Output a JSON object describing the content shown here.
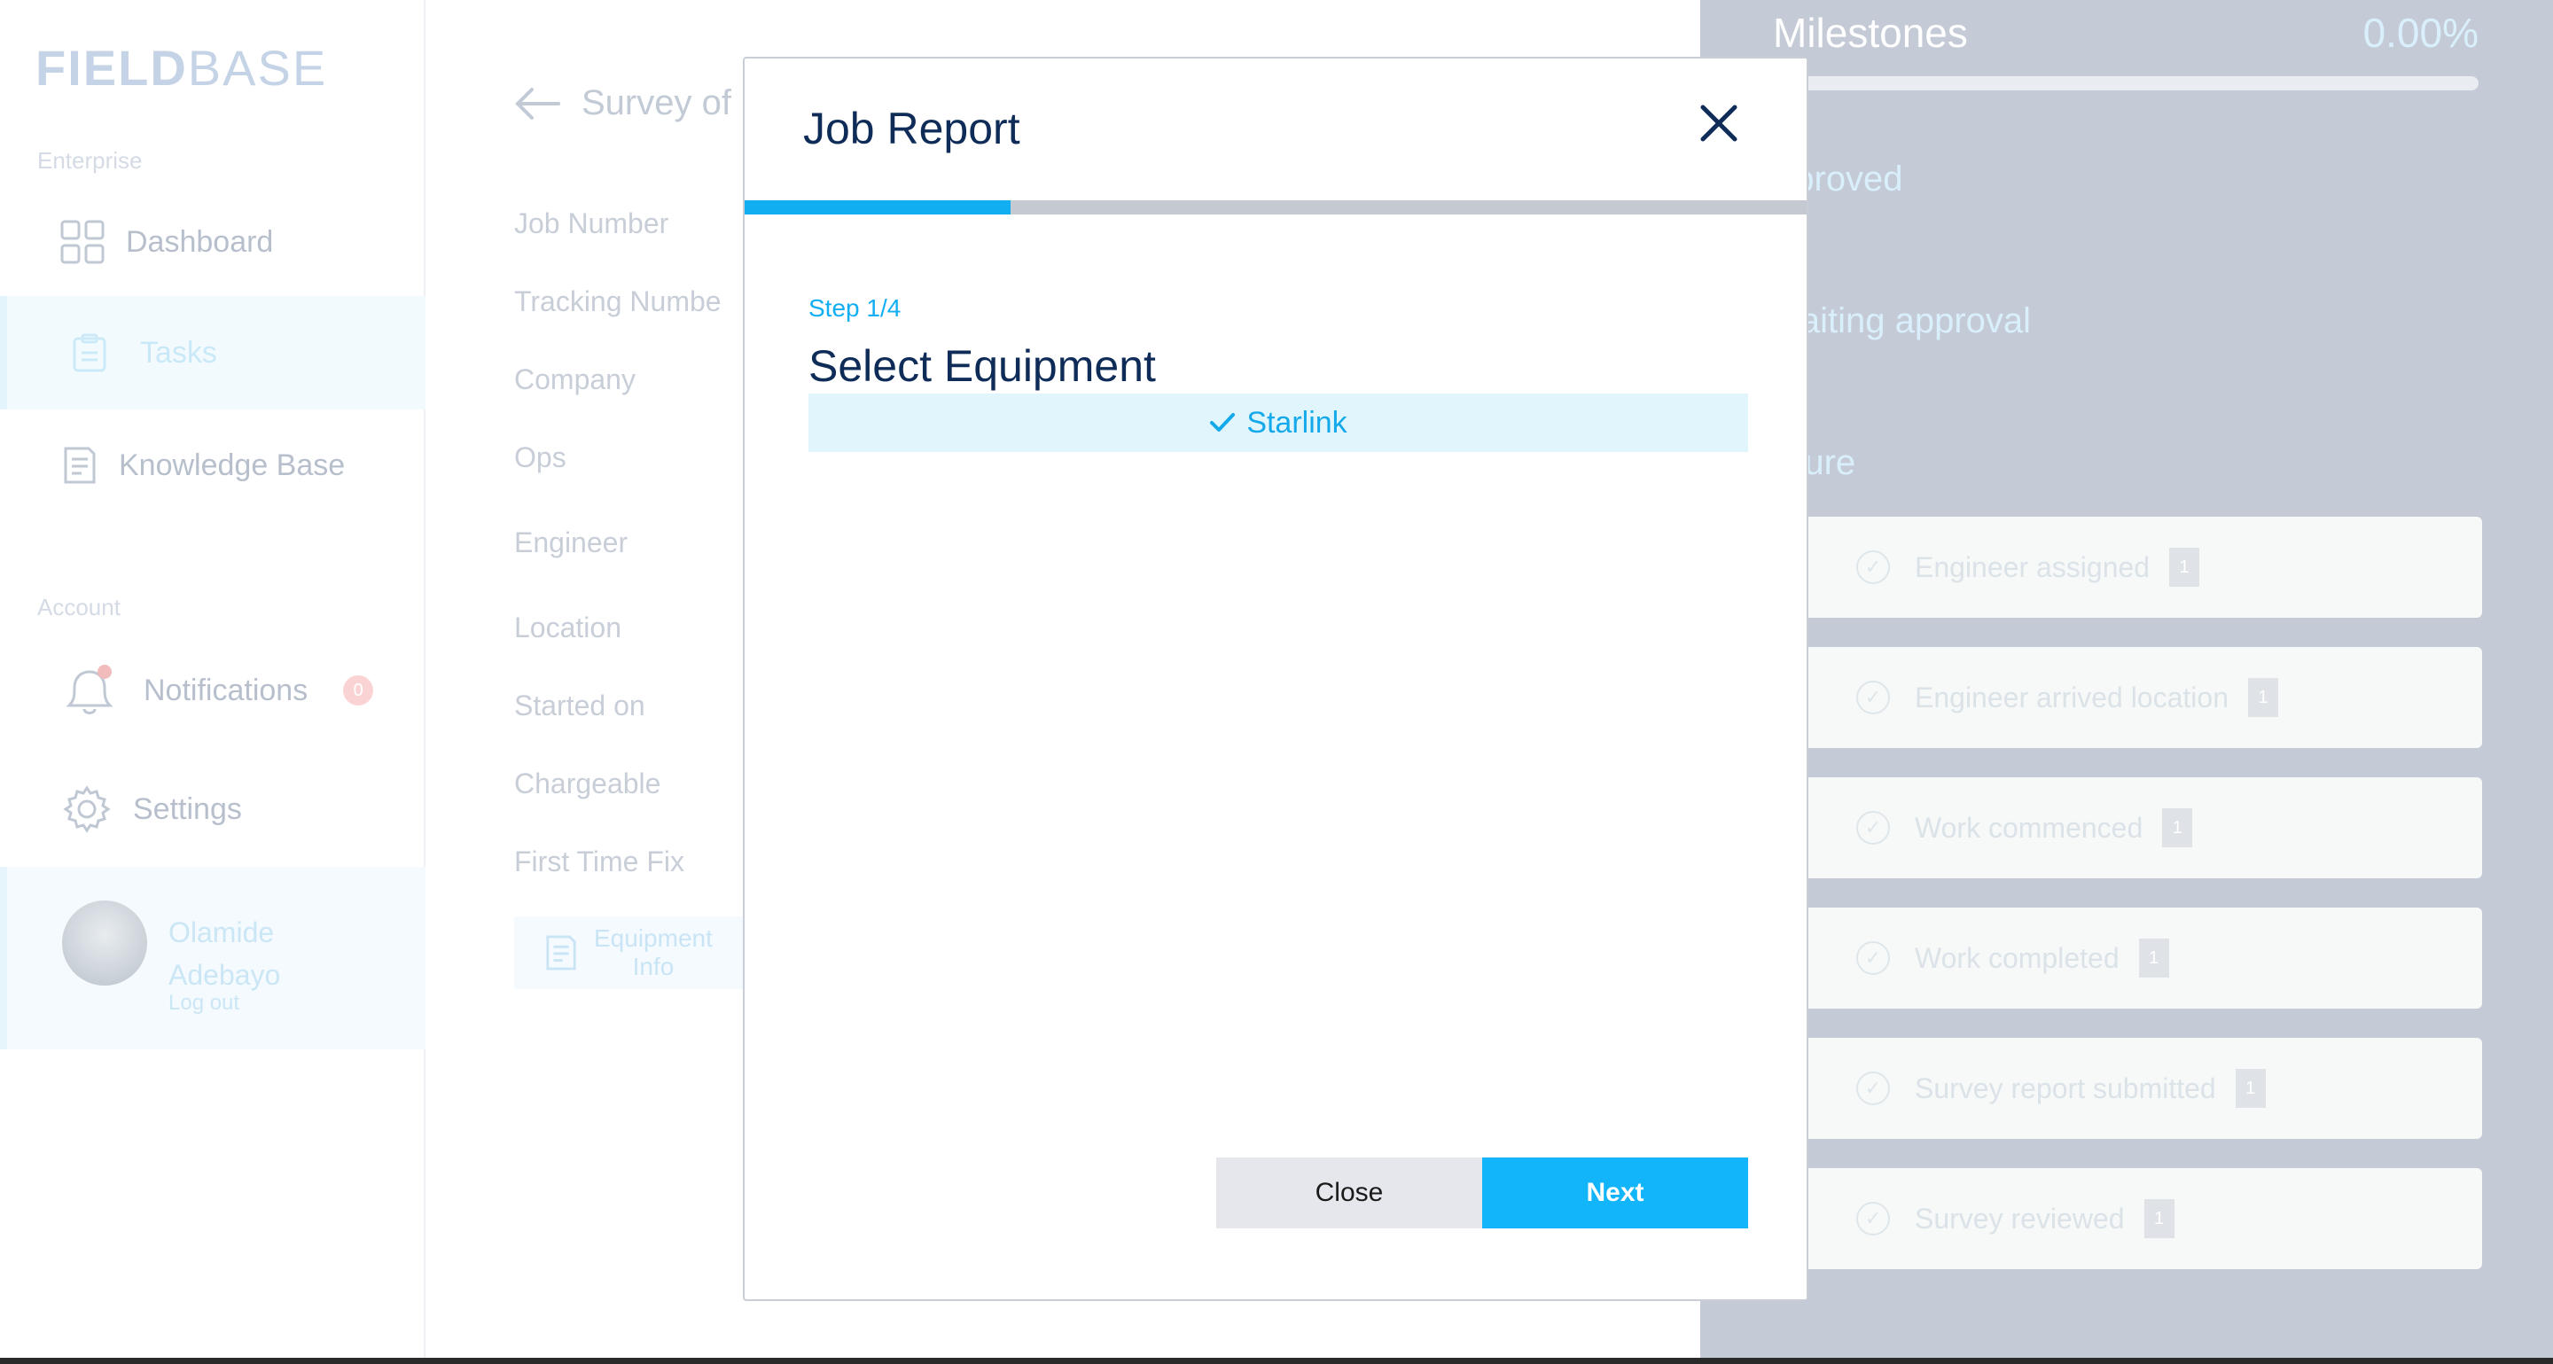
{
  "app": {
    "logo_bold": "FIELD",
    "logo_light": "BASE"
  },
  "sidebar": {
    "enterprise_label": "Enterprise",
    "account_label": "Account",
    "items": [
      {
        "label": "Dashboard",
        "icon": "grid-icon"
      },
      {
        "label": "Tasks",
        "icon": "clipboard-icon",
        "active": true
      },
      {
        "label": "Knowledge Base",
        "icon": "document-icon"
      },
      {
        "label": "Notifications",
        "icon": "bell-icon",
        "badge": "0"
      },
      {
        "label": "Settings",
        "icon": "gear-icon"
      }
    ],
    "user": {
      "first_name": "Olamide",
      "last_name": "Adebayo",
      "logout": "Log out"
    }
  },
  "job": {
    "back_title": "Survey of",
    "fields": [
      "Job Number",
      "Tracking Numbe",
      "Company",
      "Ops",
      "Engineer",
      "Location",
      "Started on",
      "Chargeable",
      "First Time Fix"
    ],
    "equipment_button_line1": "Equipment",
    "equipment_button_line2": "Info"
  },
  "milestones": {
    "title": "Milestones",
    "percent": "0.00%",
    "progress": 0,
    "approved_label": "pproved",
    "awaiting_label": "waiting approval",
    "future_label": "uture",
    "items": [
      {
        "label": "Engineer assigned",
        "count": "1"
      },
      {
        "label": "Engineer arrived location",
        "count": "1"
      },
      {
        "label": "Work commenced",
        "count": "1"
      },
      {
        "label": "Work completed",
        "count": "1"
      },
      {
        "label": "Survey report submitted",
        "count": "1"
      },
      {
        "label": "Survey reviewed",
        "count": "1"
      }
    ]
  },
  "modal": {
    "title": "Job Report",
    "step_label": "Step 1/4",
    "step_progress": 0.25,
    "section_title": "Select Equipment",
    "equipment_options": [
      {
        "label": "Starlink",
        "selected": true
      }
    ],
    "close_label": "Close",
    "next_label": "Next",
    "accent_color": "#12b4fa",
    "title_color": "#0e2c57"
  }
}
